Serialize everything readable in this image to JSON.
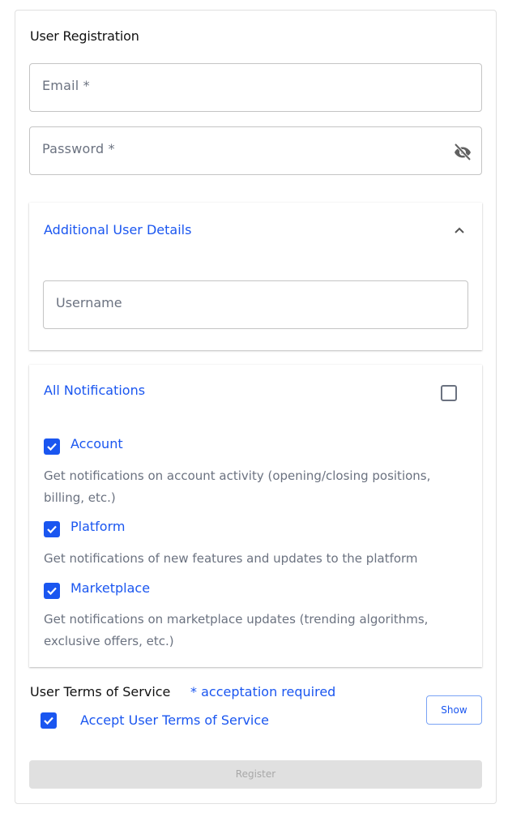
{
  "form": {
    "title": "User Registration",
    "email": {
      "placeholder": "Email *",
      "value": ""
    },
    "password": {
      "placeholder": "Password *",
      "value": "",
      "visibility_icon": "eye-off-icon"
    }
  },
  "additional_details": {
    "title": "Additional User Details",
    "expanded": true,
    "toggle_icon": "chevron-up-icon",
    "username": {
      "placeholder": "Username",
      "value": ""
    }
  },
  "notifications": {
    "title": "All Notifications",
    "all_checked": false,
    "options": [
      {
        "label": "Account",
        "checked": true,
        "description": "Get notifications on account activity (opening/closing positions, billing, etc.)"
      },
      {
        "label": "Platform",
        "checked": true,
        "description": "Get notifications of new features and updates to the platform"
      },
      {
        "label": "Marketplace",
        "checked": true,
        "description": "Get notifications on marketplace updates (trending algorithms, exclusive offers, etc.)"
      }
    ]
  },
  "terms": {
    "title": "User Terms of Service",
    "required_note": "* acceptation required",
    "accept_label": "Accept User Terms of Service",
    "accepted": true,
    "show_label": "Show"
  },
  "register": {
    "label": "Register",
    "disabled": true
  },
  "colors": {
    "accent": "#1a56f0",
    "muted_text": "#6b7280",
    "disabled_bg": "#e0e0e0"
  }
}
